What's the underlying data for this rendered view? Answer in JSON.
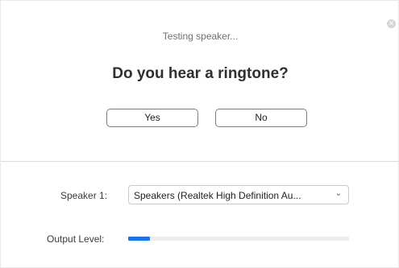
{
  "dialog": {
    "status_text": "Testing speaker...",
    "question": "Do you hear a ringtone?",
    "yes_label": "Yes",
    "no_label": "No",
    "close_icon": "close-icon"
  },
  "speaker": {
    "label": "Speaker 1:",
    "selected": "Speakers (Realtek High Definition Au...",
    "dropdown_icon": "chevron-down-icon"
  },
  "output": {
    "label": "Output Level:",
    "level": 0.1
  },
  "colors": {
    "accent": "#1a73e8"
  }
}
